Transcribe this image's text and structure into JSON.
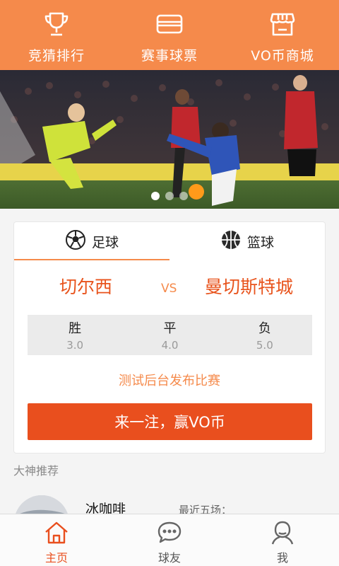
{
  "colors": {
    "accent": "#f58a4b",
    "button": "#e94f1e",
    "team_text": "#e8531c"
  },
  "top_menu": [
    {
      "label": "竞猜排行",
      "icon": "trophy-icon"
    },
    {
      "label": "赛事球票",
      "icon": "ticket-icon"
    },
    {
      "label": "VO币商城",
      "icon": "store-icon"
    }
  ],
  "banner": {
    "slide_count": 3,
    "active_slide": 1
  },
  "tabs": [
    {
      "label": "足球",
      "icon": "soccer-ball-icon",
      "active": true
    },
    {
      "label": "篮球",
      "icon": "basketball-icon",
      "active": false
    }
  ],
  "match": {
    "home_team": "切尔西",
    "vs": "VS",
    "away_team": "曼切斯特城",
    "odds": [
      {
        "label": "胜",
        "value": "3.0"
      },
      {
        "label": "平",
        "value": "4.0"
      },
      {
        "label": "负",
        "value": "5.0"
      }
    ],
    "description": "测试后台发布比赛",
    "bet_button": "来一注，赢VO币"
  },
  "experts": {
    "title": "大神推荐",
    "items": [
      {
        "name": "冰咖啡",
        "recent_label": "最近五场："
      }
    ]
  },
  "bottom_nav": [
    {
      "label": "主页",
      "icon": "home-icon",
      "active": true
    },
    {
      "label": "球友",
      "icon": "chat-icon",
      "active": false
    },
    {
      "label": "我",
      "icon": "person-icon",
      "active": false
    }
  ]
}
